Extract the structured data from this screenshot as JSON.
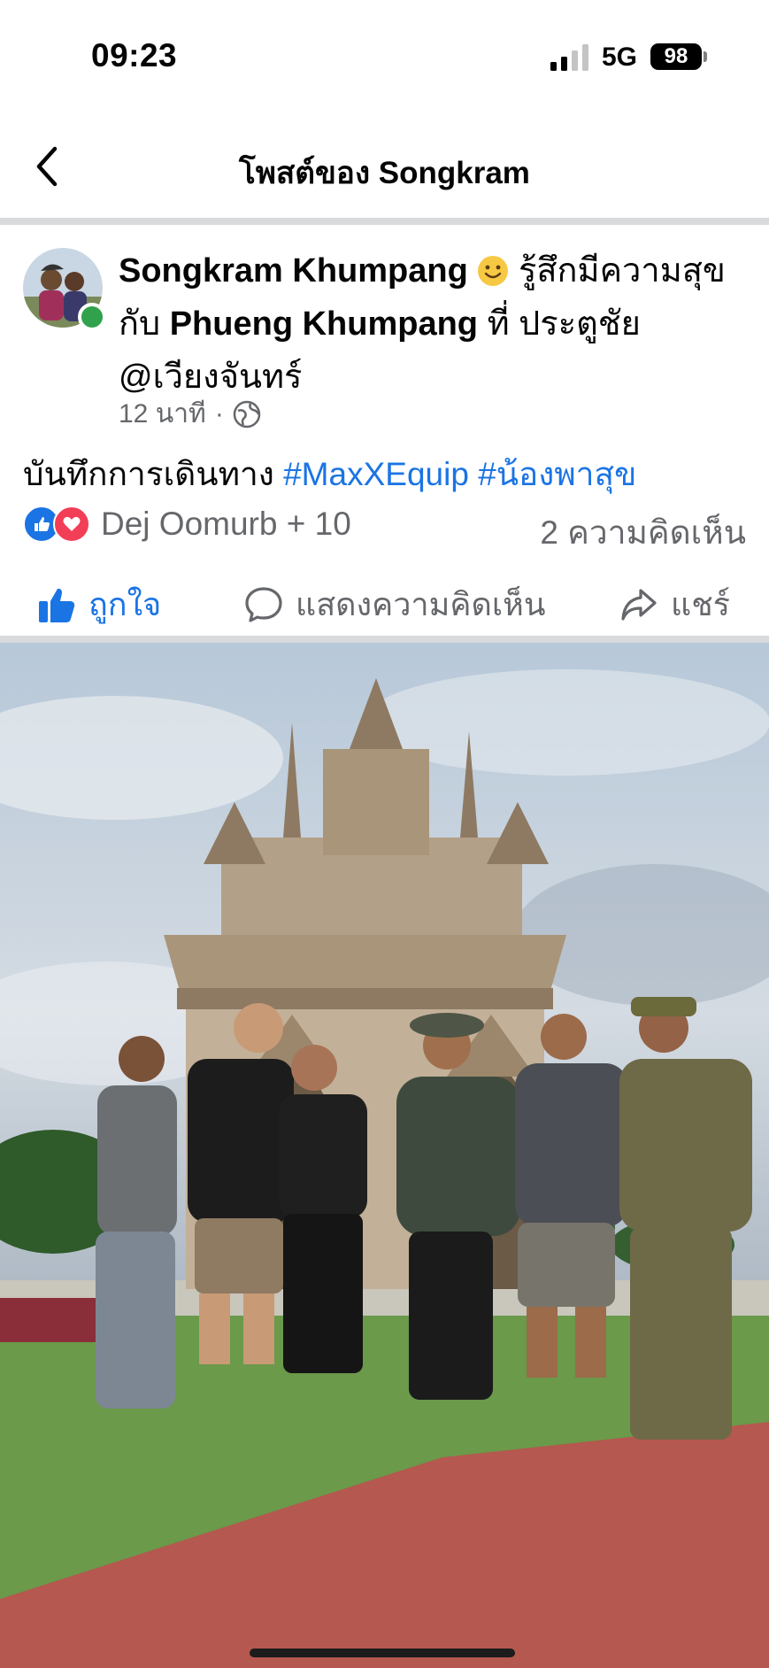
{
  "status": {
    "time": "09:23",
    "network": "5G",
    "battery": "98"
  },
  "nav": {
    "title": "โพสต์ของ Songkram",
    "back_icon": "chevron-left-icon"
  },
  "post": {
    "author": "Songkram Khumpang",
    "feeling": "รู้สึกมีความสุขกับ",
    "tagged": "Phueng Khumpang",
    "place_prefix": "ที่ ประตูชัย @เวียงจันทร์",
    "time": "12 นาที",
    "dot": "·",
    "privacy_icon": "globe-icon",
    "caption_text": "บันทึกการเดินทาง",
    "hashtags": [
      "#MaxXEquip",
      "#น้องพาสุข"
    ]
  },
  "reactions": {
    "names": "Dej Oomurb + 10",
    "comments": "2 ความคิดเห็น"
  },
  "actions": {
    "like": "ถูกใจ",
    "comment": "แสดงความคิดเห็น",
    "share": "แชร์"
  },
  "colors": {
    "accent": "#1b74e4",
    "secondary_text": "#65676b",
    "online": "#31a24c",
    "love": "#f33e58"
  }
}
